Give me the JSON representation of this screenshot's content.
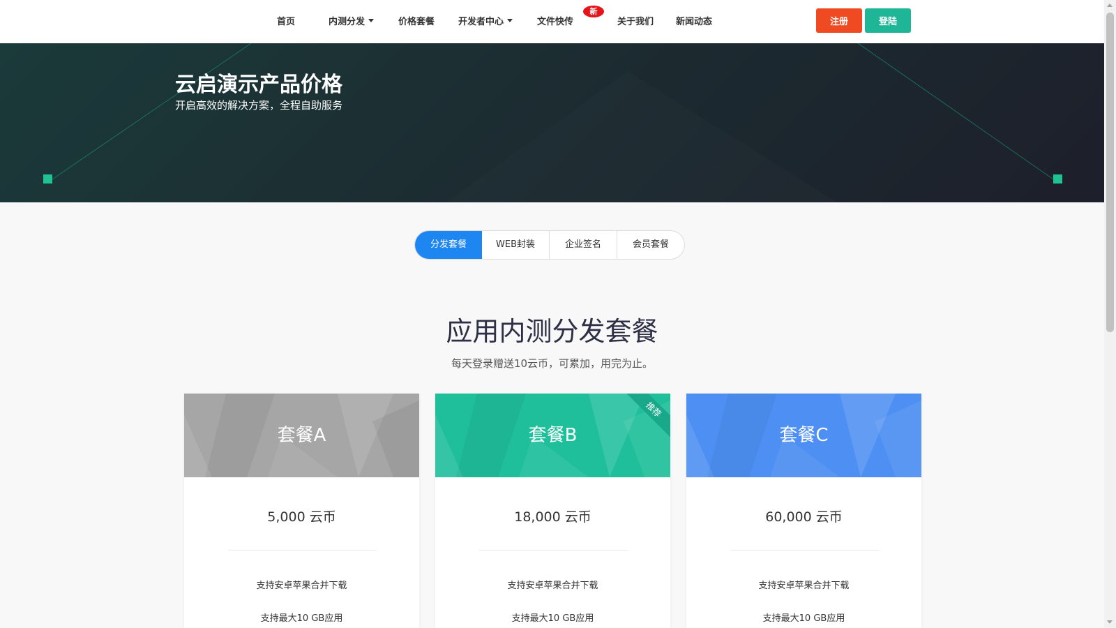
{
  "nav": {
    "items": [
      {
        "label": "首页"
      },
      {
        "label": "内测分发",
        "dropdown": true
      },
      {
        "label": "价格套餐"
      },
      {
        "label": "开发者中心",
        "dropdown": true
      },
      {
        "label": "文件快传",
        "badge": "新"
      },
      {
        "label": "关于我们"
      },
      {
        "label": "新闻动态"
      }
    ],
    "register": "注册",
    "login": "登陆",
    "colors": {
      "register": "#ef4a22",
      "login": "#1fb597",
      "badge": "#e5141b"
    }
  },
  "hero": {
    "title": "云启演示产品价格",
    "subtitle": "开启高效的解决方案，全程自助服务"
  },
  "tabs": [
    "分发套餐",
    "WEB封装",
    "企业签名",
    "会员套餐"
  ],
  "active_tab": 0,
  "section": {
    "title": "应用内测分发套餐",
    "subtitle": "每天登录赠送10云币，可累加，用完为止。"
  },
  "plans": [
    {
      "name": "套餐A",
      "price": "5,000 云币",
      "features": [
        "支持安卓苹果合并下载",
        "支持最大10 GB应用"
      ],
      "color": "#a6a6a6"
    },
    {
      "name": "套餐B",
      "price": "18,000 云币",
      "features": [
        "支持安卓苹果合并下载",
        "支持最大10 GB应用"
      ],
      "ribbon": "推荐",
      "color": "#1fbf9c"
    },
    {
      "name": "套餐C",
      "price": "60,000 云币",
      "features": [
        "支持安卓苹果合并下载",
        "支持最大10 GB应用"
      ],
      "color": "#4d8ff2"
    }
  ]
}
